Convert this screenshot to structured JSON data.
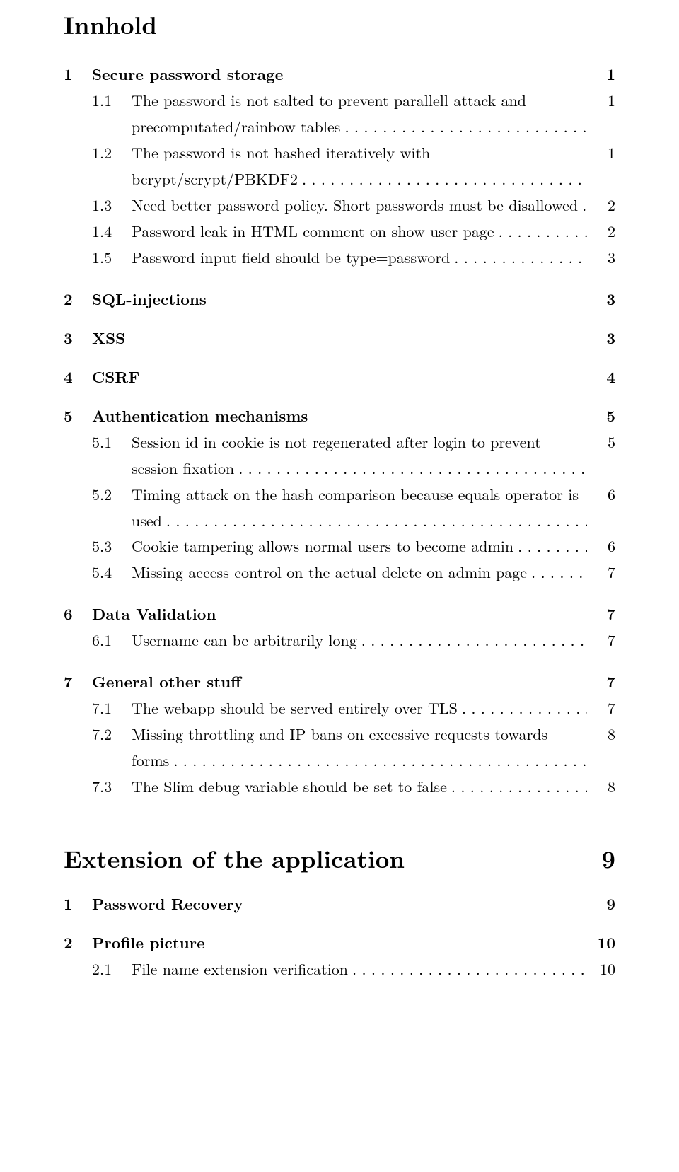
{
  "toc_title": "Innhold",
  "sections": [
    {
      "num": "1",
      "label": "Secure password storage",
      "page": "1",
      "subs": [
        {
          "num": "1.1",
          "text": "The password is not salted to prevent parallell attack and precomputated/rainbow tables",
          "page": "1"
        },
        {
          "num": "1.2",
          "text": "The password is not hashed iteratively with bcrypt/scrypt/PBKDF2",
          "page": "1"
        },
        {
          "num": "1.3",
          "text": "Need better password policy. Short passwords must be disallowed",
          "page": "2"
        },
        {
          "num": "1.4",
          "text": "Password leak in HTML comment on show user page",
          "page": "2"
        },
        {
          "num": "1.5",
          "text": "Password input field should be type=password",
          "page": "3"
        }
      ]
    },
    {
      "num": "2",
      "label": "SQL-injections",
      "page": "3",
      "subs": []
    },
    {
      "num": "3",
      "label": "XSS",
      "page": "3",
      "subs": []
    },
    {
      "num": "4",
      "label": "CSRF",
      "page": "4",
      "subs": []
    },
    {
      "num": "5",
      "label": "Authentication mechanisms",
      "page": "5",
      "subs": [
        {
          "num": "5.1",
          "text": "Session id in cookie is not regenerated after login to prevent session fixation",
          "page": "5"
        },
        {
          "num": "5.2",
          "text": "Timing attack on the hash comparison because equals operator is used",
          "page": "6"
        },
        {
          "num": "5.3",
          "text": "Cookie tampering allows normal users to become admin",
          "page": "6"
        },
        {
          "num": "5.4",
          "text": "Missing access control on the actual delete on admin page",
          "page": "7"
        }
      ]
    },
    {
      "num": "6",
      "label": "Data Validation",
      "page": "7",
      "subs": [
        {
          "num": "6.1",
          "text": "Username can be arbitrarily long",
          "page": "7"
        }
      ]
    },
    {
      "num": "7",
      "label": "General other stuff",
      "page": "7",
      "subs": [
        {
          "num": "7.1",
          "text": "The webapp should be served entirely over TLS",
          "page": "7"
        },
        {
          "num": "7.2",
          "text": "Missing throttling and IP bans on excessive requests towards forms",
          "page": "8"
        },
        {
          "num": "7.3",
          "text": "The Slim debug variable should be set to false",
          "page": "8"
        }
      ]
    }
  ],
  "part2_title": "Extension of the application",
  "part2_page": "9",
  "part2_sections": [
    {
      "num": "1",
      "label": "Password Recovery",
      "page": "9",
      "subs": []
    },
    {
      "num": "2",
      "label": "Profile picture",
      "page": "10",
      "subs": [
        {
          "num": "2.1",
          "text": "File name extension verification",
          "page": "10"
        }
      ]
    }
  ]
}
